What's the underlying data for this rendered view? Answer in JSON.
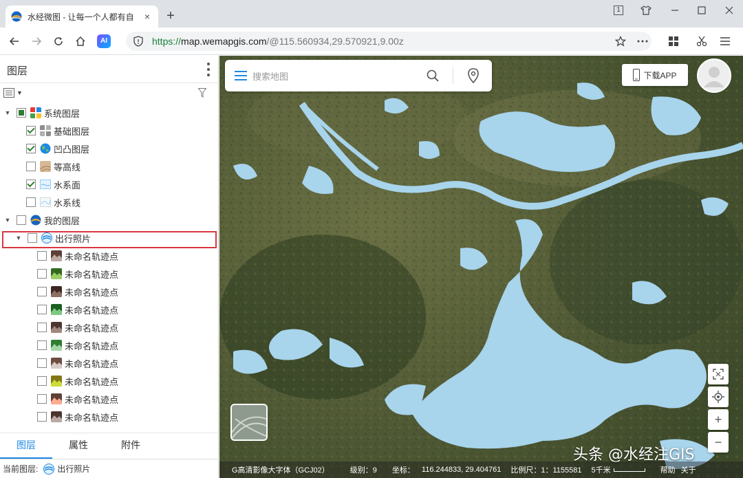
{
  "browser": {
    "tab_title": "水经微图 - 让每一个人都有自",
    "new_tab": "+",
    "tab_close": "×",
    "url_scheme": "https://",
    "url_host": "map.wemapgis.com",
    "url_path": "/@115.560934,29.570921,9.00z",
    "profile_label": "AI",
    "window_badge": "1"
  },
  "panel": {
    "title": "图层",
    "tree": {
      "system": "系统图层",
      "base": "基础图层",
      "relief": "凹凸图层",
      "contour": "等高线",
      "water_surface": "水系面",
      "water_line": "水系线",
      "mine": "我的图层",
      "travel_photos": "出行照片",
      "track_points": [
        "未命名轨迹点",
        "未命名轨迹点",
        "未命名轨迹点",
        "未命名轨迹点",
        "未命名轨迹点",
        "未命名轨迹点",
        "未命名轨迹点",
        "未命名轨迹点",
        "未命名轨迹点",
        "未命名轨迹点"
      ]
    },
    "tabs": [
      "图层",
      "属性",
      "附件"
    ],
    "status_label": "当前图层:",
    "status_value": "出行照片"
  },
  "map": {
    "search_placeholder": "搜索地图",
    "download_label": "下载APP",
    "watermark": "头条 @水经注GIS",
    "statusbar": {
      "imagery": "G高清影像大字体（GCJ02）",
      "level": "级别：9",
      "coord_label": "坐标：",
      "coord_value": "116.244833, 29.404761",
      "scale": "比例尺：1：1155581",
      "scale_bar": "5千米",
      "help": "帮助",
      "about": "关于"
    },
    "zoom_in": "+",
    "zoom_out": "−"
  },
  "colors": {
    "water": "#a8d4ec",
    "accent": "#1e88e5",
    "highlight_border": "#d9363e",
    "check": "#2e7d32"
  }
}
